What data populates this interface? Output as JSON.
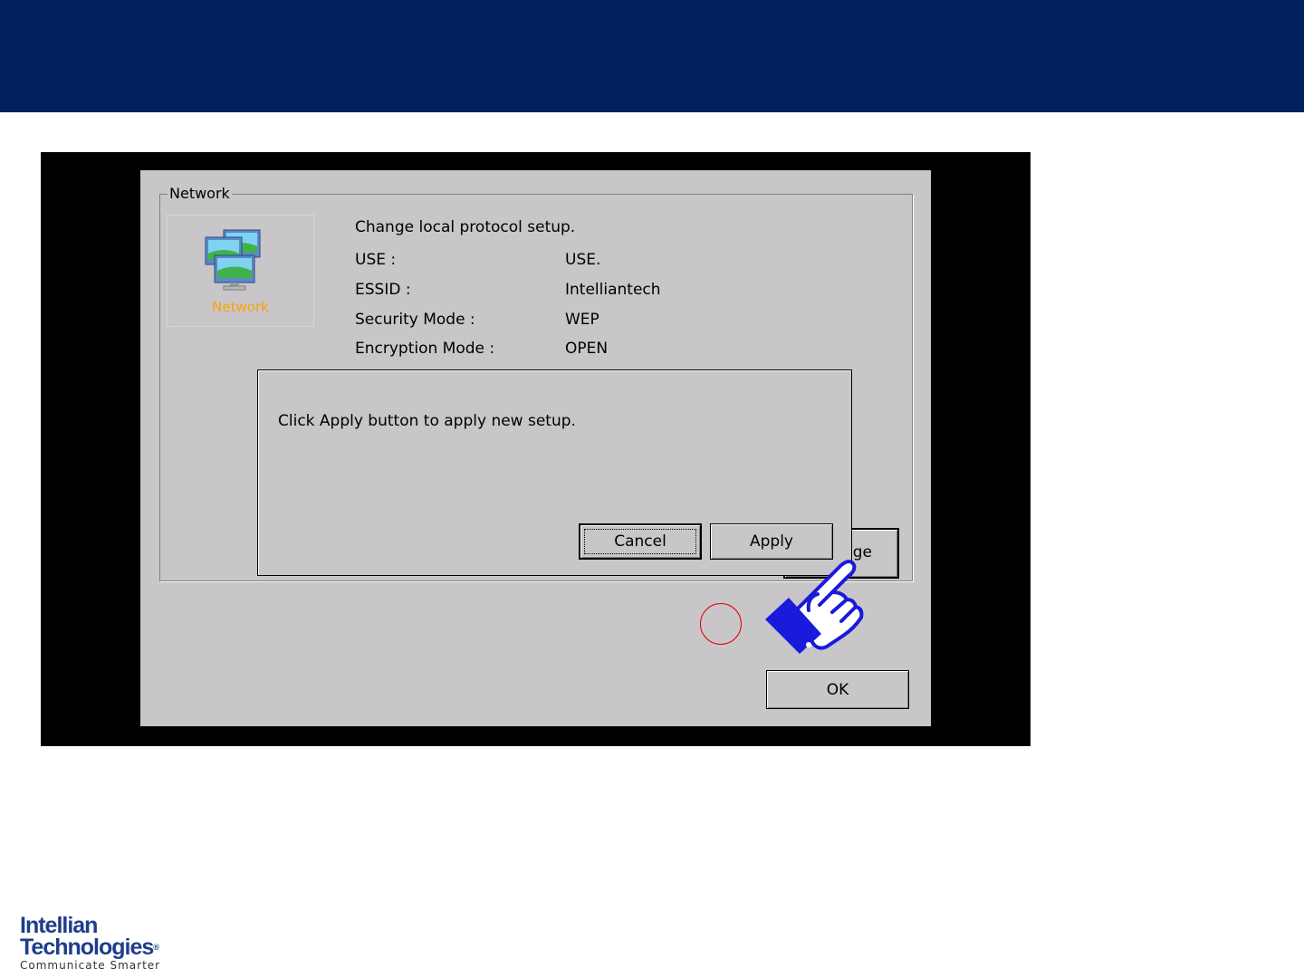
{
  "groupbox": {
    "title": "Network"
  },
  "icon_panel": {
    "label": "Network",
    "icon": "network-computers-icon"
  },
  "info": {
    "heading": "Change local protocol setup.",
    "rows": [
      {
        "label": "USE :",
        "value": "USE."
      },
      {
        "label": "ESSID :",
        "value": "Intelliantech"
      },
      {
        "label": "Security Mode :",
        "value": "WEP"
      },
      {
        "label": "Encryption Mode :",
        "value": "OPEN"
      }
    ]
  },
  "buttons": {
    "change_partial": "ge",
    "ok": "OK"
  },
  "dialog": {
    "message": "Click Apply button to apply new setup.",
    "cancel": "Cancel",
    "apply": "Apply"
  },
  "logo": {
    "line1": "Intellian",
    "line2": "Technologies",
    "tagline": "Communicate Smarter"
  },
  "colors": {
    "banner": "#00205e",
    "screen_bg": "#c8c6c8",
    "icon_label": "#f7a400",
    "highlight_circle": "#e00000",
    "hand_cuff": "#1a1adc"
  }
}
